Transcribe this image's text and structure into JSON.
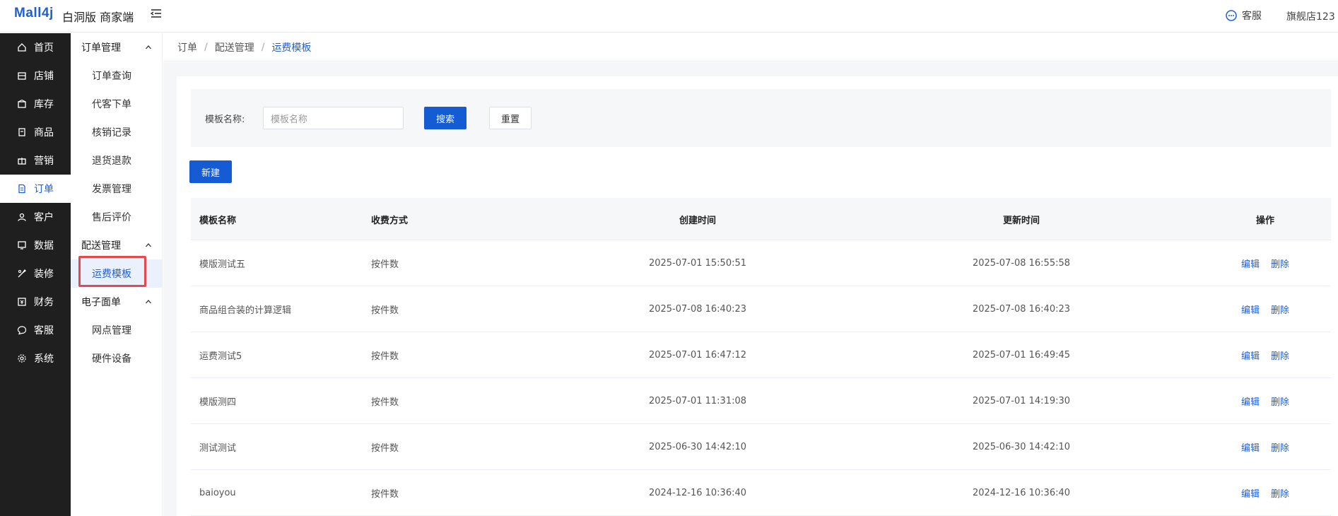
{
  "header": {
    "logo": "Mall4j",
    "brand": "白洞版 商家端",
    "service_label": "客服",
    "shop_name": "旗舰店123"
  },
  "main_nav": [
    {
      "label": "首页",
      "icon": "home-icon"
    },
    {
      "label": "店铺",
      "icon": "store-icon"
    },
    {
      "label": "库存",
      "icon": "inventory-icon"
    },
    {
      "label": "商品",
      "icon": "goods-icon"
    },
    {
      "label": "营销",
      "icon": "gift-icon"
    },
    {
      "label": "订单",
      "icon": "order-icon"
    },
    {
      "label": "客户",
      "icon": "customer-icon"
    },
    {
      "label": "数据",
      "icon": "data-icon"
    },
    {
      "label": "装修",
      "icon": "decorate-icon"
    },
    {
      "label": "财务",
      "icon": "finance-icon"
    },
    {
      "label": "客服",
      "icon": "chat-icon"
    },
    {
      "label": "系统",
      "icon": "settings-icon"
    }
  ],
  "sub_nav": {
    "group1": {
      "title": "订单管理",
      "items": [
        "订单查询",
        "代客下单",
        "核销记录",
        "退货退款",
        "发票管理",
        "售后评价"
      ]
    },
    "group2": {
      "title": "配送管理",
      "items": [
        "运费模板"
      ]
    },
    "group3": {
      "title": "电子面单",
      "items": [
        "网点管理",
        "硬件设备"
      ]
    }
  },
  "breadcrumb": [
    "订单",
    "配送管理",
    "运费模板"
  ],
  "search": {
    "label": "模板名称:",
    "placeholder": "模板名称",
    "search_button": "搜索",
    "reset_button": "重置"
  },
  "new_button": "新建",
  "table": {
    "headers": [
      "模板名称",
      "收费方式",
      "创建时间",
      "更新时间",
      "操作"
    ],
    "rows": [
      {
        "name": "模版测试五",
        "fee": "按件数",
        "created": "2025-07-01 15:50:51",
        "updated": "2025-07-08 16:55:58"
      },
      {
        "name": "商品组合装的计算逻辑",
        "fee": "按件数",
        "created": "2025-07-08 16:40:23",
        "updated": "2025-07-08 16:40:23"
      },
      {
        "name": "运费测试5",
        "fee": "按件数",
        "created": "2025-07-01 16:47:12",
        "updated": "2025-07-01 16:49:45"
      },
      {
        "name": "模版测四",
        "fee": "按件数",
        "created": "2025-07-01 11:31:08",
        "updated": "2025-07-01 14:19:30"
      },
      {
        "name": "测试测试",
        "fee": "按件数",
        "created": "2025-06-30 14:42:10",
        "updated": "2025-06-30 14:42:10"
      },
      {
        "name": "baioyou",
        "fee": "按件数",
        "created": "2024-12-16 10:36:40",
        "updated": "2024-12-16 10:36:40"
      }
    ],
    "edit_label": "编辑",
    "delete_label": "删除"
  },
  "colors": {
    "primary": "#155bd4",
    "nav_bg": "#1f1f1f",
    "highlight": "#e5484d"
  }
}
